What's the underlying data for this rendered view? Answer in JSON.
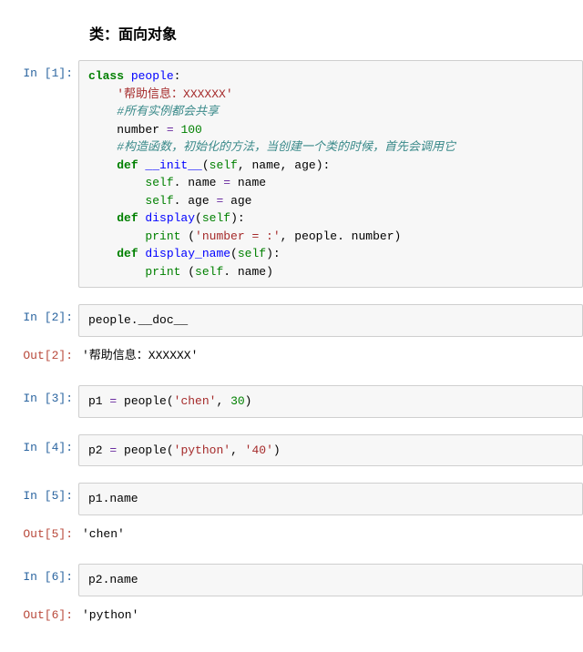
{
  "title": "类：面向对象",
  "prompts": {
    "in": "In ",
    "out": "Out"
  },
  "cells": [
    {
      "num": 1,
      "type": "in"
    },
    {
      "num": 2,
      "type": "in"
    },
    {
      "num": 2,
      "type": "out",
      "text": "'帮助信息：XXXXXX'"
    },
    {
      "num": 3,
      "type": "in"
    },
    {
      "num": 4,
      "type": "in"
    },
    {
      "num": 5,
      "type": "in"
    },
    {
      "num": 5,
      "type": "out",
      "text": "'chen'"
    },
    {
      "num": 6,
      "type": "in"
    },
    {
      "num": 6,
      "type": "out",
      "text": "'python'"
    }
  ],
  "code1": {
    "l1_kw": "class",
    "l1_name": " people",
    "l1_tail": ":",
    "l2": "'帮助信息：XXXXXX'",
    "l3": "#所有实例都会共享",
    "l4a": "number ",
    "l4b": "=",
    "l4c": " 100",
    "l5": "#构造函数，初始化的方法，当创建一个类的时候，首先会调用它",
    "l6_def": "def",
    "l6_name": " __init__",
    "l6_sig_a": "(",
    "l6_self": "self",
    "l6_sig_b": ", name, age):",
    "l7_a": "self",
    "l7_b": ". name ",
    "l7_c": "=",
    "l7_d": " name",
    "l8_a": "self",
    "l8_b": ". age ",
    "l8_c": "=",
    "l8_d": " age",
    "l9_def": "def",
    "l9_name": " display",
    "l9_sig_a": "(",
    "l9_self": "self",
    "l9_sig_b": "):",
    "l10_a": "print",
    "l10_b": " (",
    "l10_c": "'number = :'",
    "l10_d": ", people. number)",
    "l11_def": "def",
    "l11_name": " display_name",
    "l11_sig_a": "(",
    "l11_self": "self",
    "l11_sig_b": "):",
    "l12_a": "print",
    "l12_b": " (",
    "l12_self": "self",
    "l12_c": ". name)"
  },
  "code2": "people.__doc__",
  "code3": {
    "a": "p1 ",
    "eq": "=",
    "b": " people(",
    "s": "'chen'",
    "c": ", ",
    "n": "30",
    "d": ")"
  },
  "code4": {
    "a": "p2 ",
    "eq": "=",
    "b": " people(",
    "s1": "'python'",
    "c": ", ",
    "s2": "'40'",
    "d": ")"
  },
  "code5": "p1.name",
  "code6": "p2.name",
  "chart_data": null
}
